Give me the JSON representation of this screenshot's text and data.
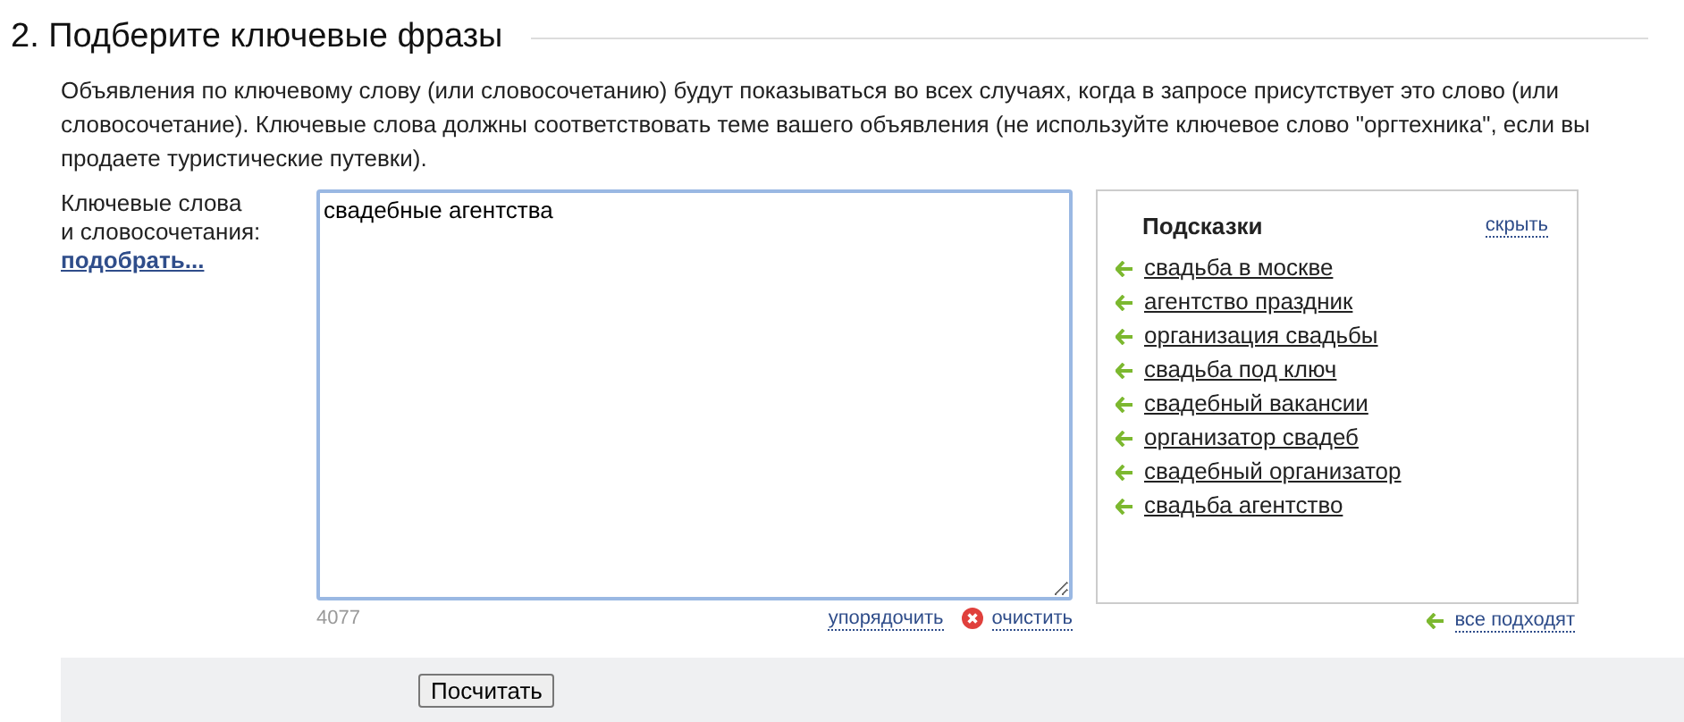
{
  "section": {
    "title": "2. Подберите ключевые фразы",
    "description": "Объявления по ключевому слову (или словосочетанию) будут показываться во всех случаях, когда в запросе присутствует это слово (или словосочетание). Ключевые слова должны соответствовать теме вашего объявления (не используйте ключевое слово \"оргтехника\", если вы продаете туристические путевки)."
  },
  "keywords": {
    "label_lines": [
      "Ключевые слова",
      "и словосочетания:"
    ],
    "pick_link": "подобрать...",
    "value": "свадебные агентства",
    "counter": "4077",
    "sort_link": "упорядочить",
    "clear_link": "очистить"
  },
  "suggestions": {
    "title": "Подсказки",
    "hide_link": "скрыть",
    "items": [
      {
        "text": "свадьба в москве"
      },
      {
        "text": "агентство праздник"
      },
      {
        "text": "организация свадьбы"
      },
      {
        "text": "свадьба под ключ"
      },
      {
        "text": "свадебный вакансии"
      },
      {
        "text": "организатор свадеб"
      },
      {
        "text": "свадебный организатор"
      },
      {
        "text": "свадьба агентство"
      }
    ],
    "all_link": "все подходят"
  },
  "footer": {
    "button": "Посчитать"
  }
}
